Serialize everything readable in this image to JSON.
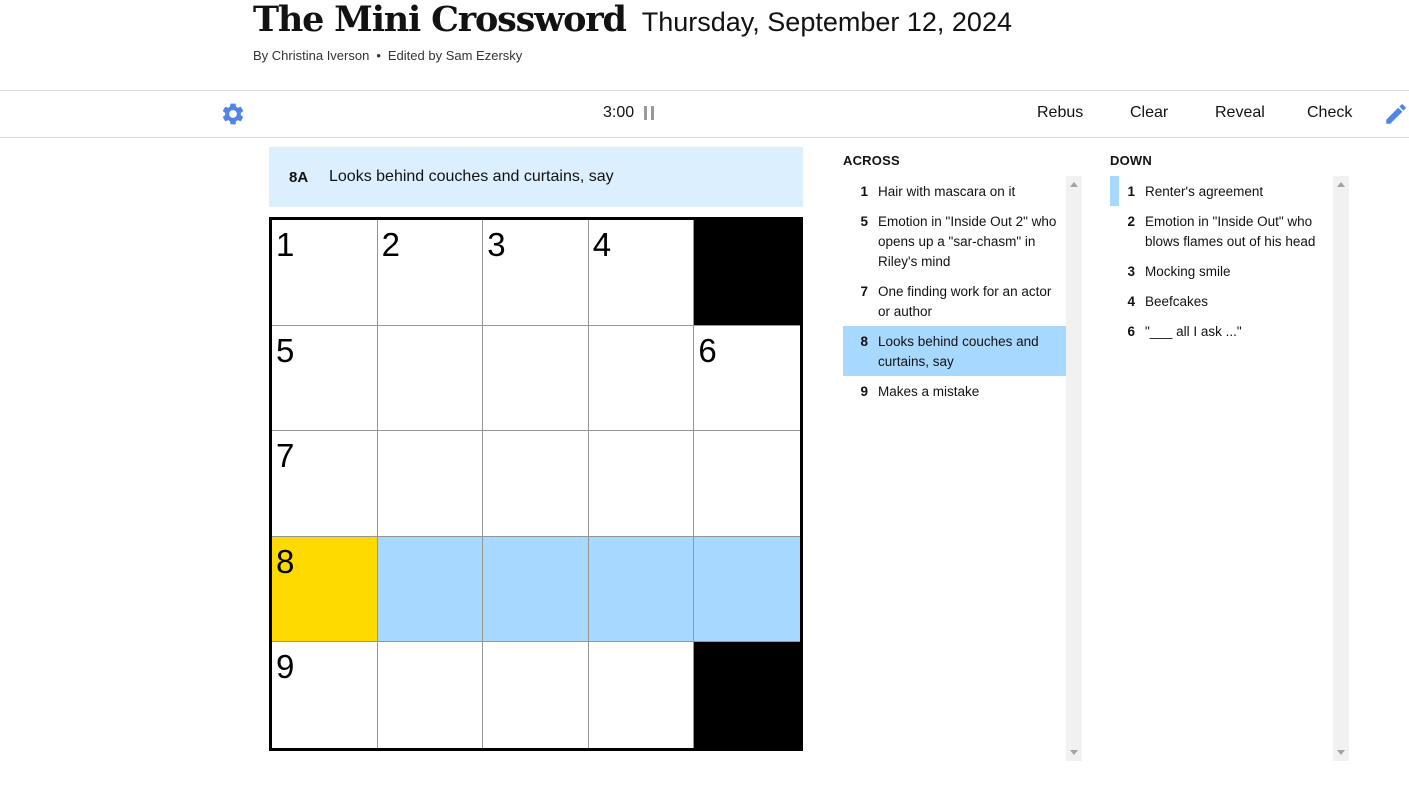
{
  "header": {
    "title": "The Mini Crossword",
    "date": "Thursday, September 12, 2024",
    "author": "By Christina Iverson",
    "separator": "•",
    "editor": "Edited by Sam Ezersky"
  },
  "toolbar": {
    "timer": "3:00",
    "rebus_label": "Rebus",
    "clear_label": "Clear",
    "reveal_label": "Reveal",
    "check_label": "Check"
  },
  "current_clue": {
    "label": "8A",
    "text": "Looks behind couches and curtains, say"
  },
  "grid": {
    "numbers": {
      "r0c0": "1",
      "r0c1": "2",
      "r0c2": "3",
      "r0c3": "4",
      "r1c0": "5",
      "r1c4": "6",
      "r2c0": "7",
      "r3c0": "8",
      "r4c0": "9"
    }
  },
  "across": {
    "heading": "ACROSS",
    "clues": [
      {
        "num": "1",
        "text": "Hair with mascara on it"
      },
      {
        "num": "5",
        "text": "Emotion in \"Inside Out 2\" who opens up a \"sar-chasm\" in Riley's mind"
      },
      {
        "num": "7",
        "text": "One finding work for an actor or author"
      },
      {
        "num": "8",
        "text": "Looks behind couches and curtains, say"
      },
      {
        "num": "9",
        "text": "Makes a mistake"
      }
    ]
  },
  "down": {
    "heading": "DOWN",
    "clues": [
      {
        "num": "1",
        "text": "Renter's agreement"
      },
      {
        "num": "2",
        "text": "Emotion in \"Inside Out\" who blows flames out of his head"
      },
      {
        "num": "3",
        "text": "Mocking smile"
      },
      {
        "num": "4",
        "text": "Beefcakes"
      },
      {
        "num": "6",
        "text": "\"___ all I ask ...\""
      }
    ]
  },
  "colors": {
    "active_cell": "#ffda00",
    "highlight": "#a7d8ff",
    "clue_bar": "#dcefff",
    "icon_blue": "#4f85e5"
  }
}
